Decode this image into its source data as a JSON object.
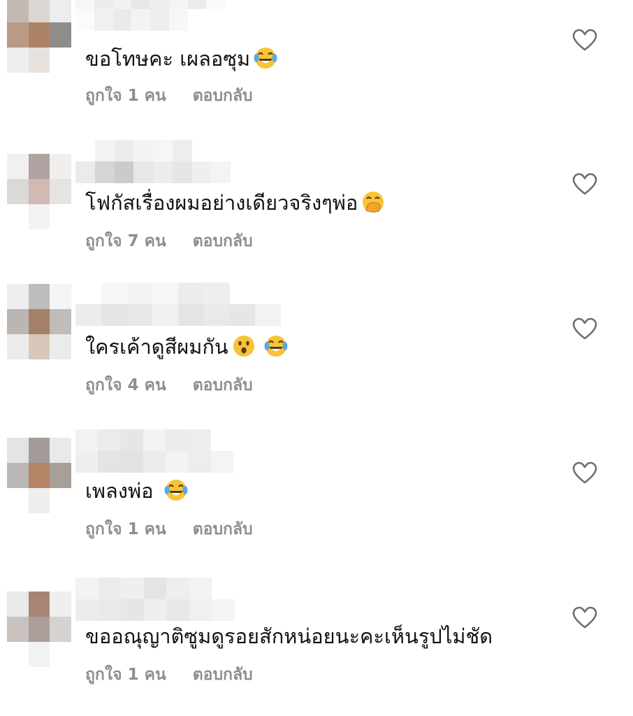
{
  "comments": [
    {
      "text": "ขอโทษคะ เผลอซุม",
      "emojis": [
        "tears-of-joy"
      ],
      "likes_label": "ถูกใจ 1 คน",
      "reply_label": "ตอบกลับ",
      "avatar_colors": [
        "#c4b9b1",
        "#dcd6d2",
        "#ededed",
        "#b99a86",
        "#ad8366",
        "#8f8d8c",
        "#efeeee",
        "#e7e2de",
        "#ffffff"
      ]
    },
    {
      "text": "โฟกัสเรื่องผมอย่างเดียวจริงๆพ่อ",
      "emojis": [
        "hand-over-mouth"
      ],
      "likes_label": "ถูกใจ 7 คน",
      "reply_label": "ตอบกลับ",
      "avatar_colors": [
        "#f0f0f0",
        "#b1a3a1",
        "#f2eeec",
        "#dcd8d6",
        "#d1b9b4",
        "#e7e3e1",
        "#ffffff",
        "#f3f3f3",
        "#ffffff"
      ]
    },
    {
      "text": "ใครเค้าดูสีผมกัน",
      "emojis": [
        "hushed-face",
        "tears-of-joy"
      ],
      "likes_label": "ถูกใจ 4 คน",
      "reply_label": "ตอบกลับ",
      "avatar_colors": [
        "#eeeeee",
        "#bdbdbd",
        "#f5f5f5",
        "#bcb6b2",
        "#a58068",
        "#bfbcba",
        "#ebebeb",
        "#d9c8b9",
        "#ebebeb"
      ]
    },
    {
      "text": "เพลงพ่อ",
      "emojis": [
        "tears-of-joy"
      ],
      "likes_label": "ถูกใจ 1 คน",
      "reply_label": "ตอบกลับ",
      "avatar_colors": [
        "#e4e4e4",
        "#a39c98",
        "#e9e9e9",
        "#bab7b5",
        "#b58568",
        "#a89f98",
        "#ffffff",
        "#eeeeee",
        "#ffffff"
      ]
    },
    {
      "text": "ขออณุญาติซูมดูรอยสักหน่อยนะคะเห็นรูปไม่ชัด",
      "emojis": [],
      "likes_label": "ถูกใจ 1 คน",
      "reply_label": "ตอบกลับ",
      "avatar_colors": [
        "#e9e9e9",
        "#a68574",
        "#efefef",
        "#c9c3bf",
        "#ac9e98",
        "#d6d2cf",
        "#ffffff",
        "#f2f2f2",
        "#ffffff"
      ]
    }
  ]
}
